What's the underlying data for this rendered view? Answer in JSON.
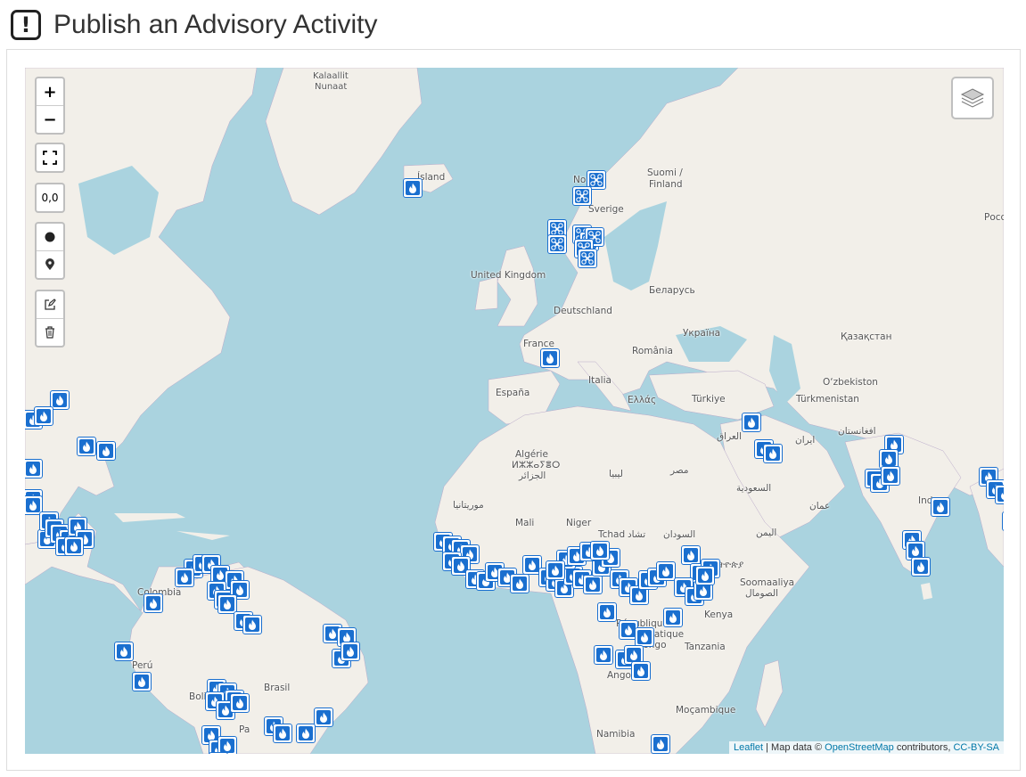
{
  "header": {
    "title": "Publish an Advisory Activity",
    "icon": "exclamation-square-icon"
  },
  "controls": {
    "zoom_in": "+",
    "zoom_out": "−",
    "fullscreen_icon": "fullscreen-icon",
    "coords_label": "0,0",
    "circle_icon": "circle-marker-icon",
    "pin_icon": "map-pin-icon",
    "edit_icon": "edit-icon",
    "delete_icon": "trash-icon",
    "layers_icon": "layers-icon"
  },
  "attribution": {
    "leaflet": "Leaflet",
    "sep": " | Map data © ",
    "osm": "OpenStreetMap",
    "contrib": " contributors, ",
    "license": "CC-BY-SA"
  },
  "labels": {
    "kalaallit": "Kalaallit",
    "nunaat": "Nunaat",
    "island": "Ísland",
    "norge": "No",
    "suomi": "Suomi /",
    "finland": "Finland",
    "sverige": "Sverige",
    "uk": "United Kingdom",
    "belarus": "Беларусь",
    "deutschland": "Deutschland",
    "ukraina": "Україна",
    "kazakhstan": "Қазақстан",
    "france": "France",
    "romania": "România",
    "espana": "España",
    "italia": "Italia",
    "turkiye": "Türkiye",
    "ellas": "Ελλάς",
    "uzbekistan": "O‘zbekiston",
    "turkmenistan": "Türkmenistan",
    "iraq": "العراق",
    "iran": "ایران",
    "afghanistan": "افغانستان",
    "algerie": "Algérie",
    "algerie2": "ⵍⵣⵣⴰⵢⴻⵔ",
    "algerie3": "الجزائر",
    "libya": "ليبيا",
    "misr": "مصر",
    "saudi": "السعودية",
    "oman": "عمان",
    "mauritania": "موريتانيا",
    "mali": "Mali",
    "niger": "Niger",
    "tchad": "Tchad",
    "tchad_ar": "تشاد",
    "sudan": "السودان",
    "yemen": "اليمن",
    "india": "Ind",
    "somalia": "Soomaaliya",
    "somalia_ar": "الصومال",
    "ethiopia": "ኢትዮጵያ",
    "kenya": "Kenya",
    "rep": "République",
    "democratique": "démocratique",
    "congo": "Congo",
    "tanzania": "Tanzania",
    "angola": "Angola",
    "mocambique": "Moçambique",
    "namibia": "Namibia",
    "colombia": "Colombia",
    "peru": "Perú",
    "brasil": "Brasil",
    "bolivia": "Boli",
    "paraguay": "Pa",
    "rossiya": "Росс"
  },
  "markers": {
    "fire_icon": "fire-icon",
    "drone_icon": "drone-icon"
  }
}
